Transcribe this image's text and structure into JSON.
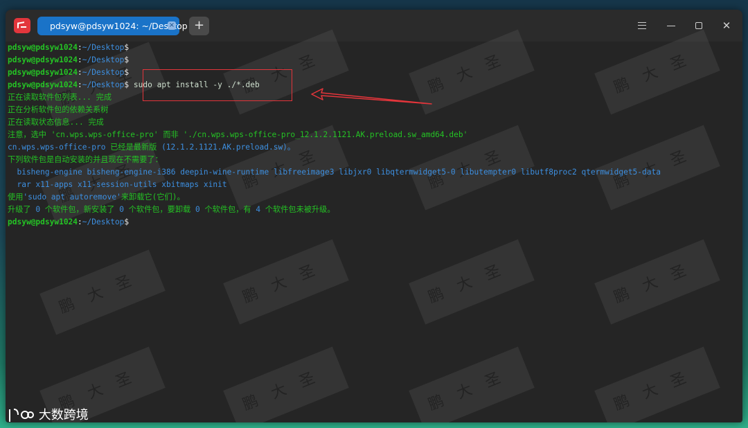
{
  "tab": {
    "title": "pdsyw@pdsyw1024: ~/Desktop",
    "close": "×"
  },
  "toolbar": {
    "add_tab": "+"
  },
  "prompt": {
    "user": "pdsyw@pdsyw1024",
    "sep": ":",
    "path": "~/Desktop",
    "dollar": "$"
  },
  "command": "sudo apt install -y ./*.deb",
  "output": {
    "l1": "正在读取软件包列表... 完成",
    "l2": "正在分析软件包的依赖关系树",
    "l3": "正在读取状态信息... 完成",
    "l4a": "注意，选中 ",
    "l4b": "'cn.wps.wps-office-pro'",
    "l4c": " 而非 ",
    "l4d": "'./cn.wps.wps-office-pro_12.1.2.1121.AK.preload.sw_amd64.deb'",
    "l5a": "cn.wps.wps-office-pro",
    "l5b": " 已经是最新版 ",
    "l5c": "(12.1.2.1121.AK.preload.sw)。",
    "l6": "下列软件包是自动安装的并且现在不需要了：",
    "l7": "  bisheng-engine bisheng-engine-i386 deepin-wine-runtime libfreeimage3 libjxr0 libqtermwidget5-0 libutempter0 libutf8proc2 qtermwidget5-data",
    "l8": "  rar x11-apps x11-session-utils xbitmaps xinit",
    "l9a": "使用",
    "l9b": "'sudo apt autoremove'",
    "l9c": "来卸载它(它们)。",
    "l10a": "升级了 ",
    "l10b": "0",
    "l10c": " 个软件包，新安装了 ",
    "l10d": "0",
    "l10e": " 个软件包，要卸载 ",
    "l10f": "0",
    "l10g": " 个软件包，有 ",
    "l10h": "4",
    "l10i": " 个软件包未被升级。"
  },
  "watermark": {
    "text": "鹏大圣"
  },
  "brand": {
    "text": "大数跨境"
  },
  "colors": {
    "prompt_green": "#25c225",
    "path_blue": "#3d8fe0",
    "highlight_red": "#e4353b",
    "tab_blue": "#1a73c8"
  }
}
